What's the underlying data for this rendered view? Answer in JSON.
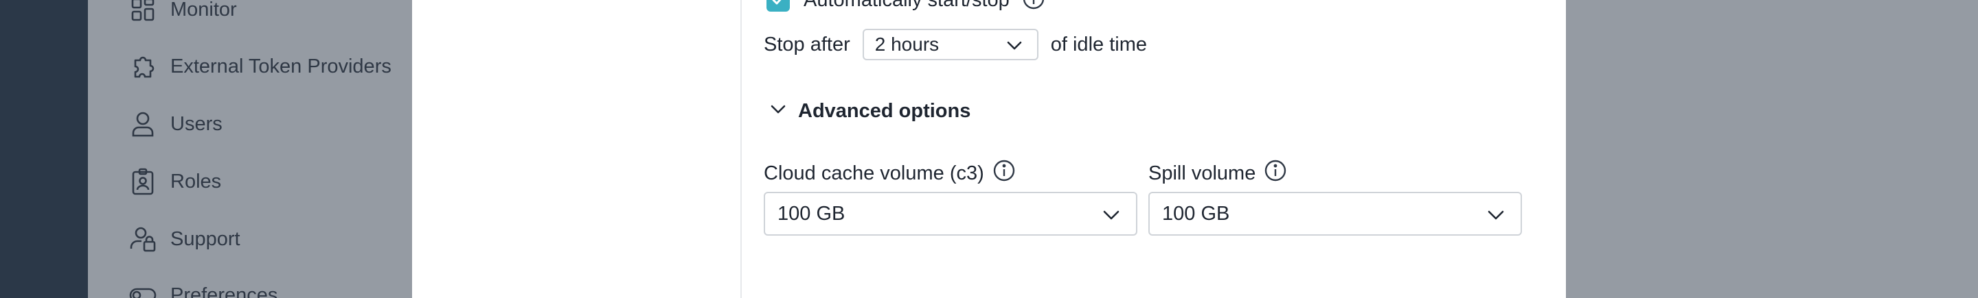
{
  "sidebar": {
    "items": [
      {
        "label": "Monitor",
        "icon": "dashboard-icon"
      },
      {
        "label": "External Token Providers",
        "icon": "puzzle-icon"
      },
      {
        "label": "Users",
        "icon": "user-icon"
      },
      {
        "label": "Roles",
        "icon": "badge-icon"
      },
      {
        "label": "Support",
        "icon": "support-icon"
      },
      {
        "label": "Preferences",
        "icon": "toggle-icon"
      }
    ]
  },
  "modal": {
    "auto_start_stop": {
      "label": "Automatically start/stop",
      "checked": true
    },
    "stop_after": {
      "prefix": "Stop after",
      "value": "2 hours",
      "suffix": "of idle time"
    },
    "advanced": {
      "label": "Advanced options",
      "expanded": true
    },
    "cloud_cache": {
      "label": "Cloud cache volume (c3)",
      "value": "100 GB"
    },
    "spill_volume": {
      "label": "Spill volume",
      "value": "100 GB"
    }
  },
  "colors": {
    "sidebar_bg": "#959ba3",
    "rail_bg": "#2b3848",
    "accent": "#3ab0c3",
    "modal_bg": "#ffffff"
  }
}
